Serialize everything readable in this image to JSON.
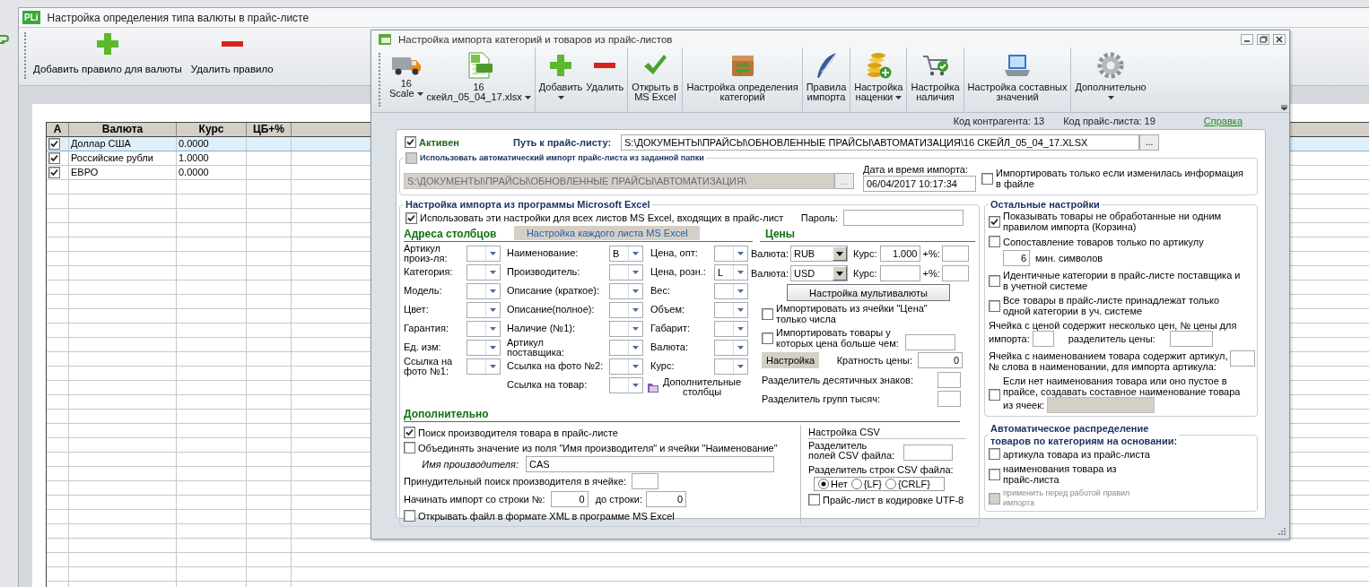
{
  "background_window": {
    "logo": "PLi",
    "title": "Настройка определения типа валюты в прайс-листе",
    "toolbar": [
      {
        "label": "Добавить правило для валюты"
      },
      {
        "label": "Удалить правило"
      }
    ],
    "table": {
      "check_column": "А",
      "columns": [
        "Валюта",
        "Курс",
        "ЦБ+%"
      ],
      "rows": [
        {
          "selected": true,
          "checked": true,
          "cells": [
            "Доллар США",
            "0.0000"
          ]
        },
        {
          "selected": false,
          "checked": true,
          "cells": [
            "Российские рубли",
            "1.0000"
          ]
        },
        {
          "selected": false,
          "checked": true,
          "cells": [
            "ЕВРО",
            "0.0000"
          ]
        }
      ]
    }
  },
  "dialog": {
    "title": "Настройка импорта категорий и товаров из прайс-листов",
    "toolbar": [
      [
        {
          "caption": "16",
          "label": "Scale",
          "dropdown": true
        },
        {
          "caption": "16",
          "label": "скейл_05_04_17.xlsx",
          "dropdown": true
        }
      ],
      [
        {
          "label": "Добавить",
          "dropdown": true
        },
        {
          "label": "Удалить",
          "dropdown": false
        }
      ],
      [
        {
          "label": "Открыть в\nMS Excel",
          "dropdown": false
        }
      ],
      [
        {
          "label": "Настройка определения\nкатегорий",
          "dropdown": false
        }
      ],
      [
        {
          "label": "Правила\nимпорта",
          "dropdown": false
        }
      ],
      [
        {
          "label": "Настройка\nнаценки",
          "dropdown": true
        }
      ],
      [
        {
          "label": "Настройка\nналичия",
          "dropdown": false
        }
      ],
      [
        {
          "label": "Настройка составных\nзначений",
          "dropdown": false
        }
      ],
      [
        {
          "label": "Дополнительно",
          "dropdown": true
        }
      ]
    ],
    "info": {
      "counterparty": "Код контрагента: 13",
      "pricelist": "Код прайс-листа: 19",
      "help": "Справка"
    },
    "active": {
      "label": "Активен",
      "checked": true
    },
    "path": {
      "label": "Путь к прайс-листу:",
      "value": "S:\\ДОКУМЕНТЫ\\ПРАЙСЫ\\ОБНОВЛЕННЫЕ ПРАЙСЫ\\АВТОМАТИЗАЦИЯ\\16 СКЕЙЛ_05_04_17.XLSX",
      "browse": "..."
    },
    "auto_import": {
      "label": "Использовать автоматический импорт прайс-листа из заданной папки",
      "checked": false,
      "folder": "S:\\ДОКУМЕНТЫ\\ПРАЙСЫ\\ОБНОВЛЕННЫЕ ПРАЙСЫ\\АВТОМАТИЗАЦИЯ\\",
      "browse": "...",
      "disabled": true,
      "date_label": "Дата и время импорта:",
      "date_value": "06/04/2017 10:17:34",
      "only_changed": {
        "label": "Импортировать только если изменилась информация\nв файле",
        "checked": false
      }
    },
    "excel": {
      "title": "Настройка импорта из программы Microsoft Excel",
      "all_sheets": {
        "label": "Использовать эти настройки для всех листов MS Excel, входящих в прайс-лист",
        "checked": true
      },
      "password_label": "Пароль:",
      "columns_title": "Адреса столбцов",
      "each_sheet_button": "Настройка каждого листа MS Excel",
      "column_groups": [
        [
          {
            "label": "Артикул\nпроиз-ля:"
          },
          {
            "label": "Категория:"
          },
          {
            "label": "Модель:"
          },
          {
            "label": "Цвет:"
          },
          {
            "label": "Гарантия:"
          },
          {
            "label": "Ед. изм:"
          },
          {
            "label": "Ссылка на\nфото №1:"
          }
        ],
        [
          {
            "label": "Наименование:",
            "value": "B"
          },
          {
            "label": "Производитель:"
          },
          {
            "label": "Описание (краткое):"
          },
          {
            "label": "Описание(полное):"
          },
          {
            "label": "Наличие (№1):"
          },
          {
            "label": "Артикул\nпоставщика:"
          },
          {
            "label": "Ссылка на фото №2:"
          },
          {
            "label": "Ссылка на товар:"
          }
        ],
        [
          {
            "label": "Цена, опт:"
          },
          {
            "label": "Цена, розн.:",
            "value": "L"
          },
          {
            "label": "Вес:"
          },
          {
            "label": "Объем:"
          },
          {
            "label": "Габарит:"
          },
          {
            "label": "Валюта:"
          },
          {
            "label": "Курс:"
          }
        ]
      ],
      "extra_columns": "Дополнительные\nстолбцы",
      "prices": {
        "title": "Цены",
        "currencies": [
          {
            "label": "Валюта:",
            "value": "RUB",
            "rate_label": "Курс:",
            "rate": "1.000",
            "percent_label": "+%:"
          },
          {
            "label": "Валюта:",
            "value": "USD",
            "rate_label": "Курс:",
            "percent_label": "+%:"
          }
        ],
        "multi_button": "Настройка мультивалюты",
        "numbers_only": {
          "label": "Импортировать из ячейки \"Цена\"\nтолько числа",
          "checked": false
        },
        "min_price": {
          "label": "Импортировать товары у\nкоторых цена больше чем:",
          "checked": false
        },
        "settings_button": "Настройка",
        "multiplicity_label": "Кратность цены:",
        "multiplicity": "0",
        "decimal_label": "Разделитель десятичных знаков:",
        "thousands_label": "Разделитель групп тысяч:"
      },
      "more_title": "Дополнительно",
      "more": {
        "find_maker": {
          "label": "Поиск производителя товара в прайс-листе",
          "checked": true
        },
        "merge": {
          "label": "Объединять значение из поля \"Имя производителя\" и ячейки \"Наименование\"",
          "checked": false
        },
        "maker_label": "Имя производителя:",
        "maker_value": "CAS",
        "forced_label": "Принудительный поиск производителя в ячейке:",
        "start_label": "Начинать импорт со строки №:",
        "start_value": "0",
        "end_label": "до строки:",
        "end_value": "0",
        "xml": {
          "label": "Открывать файл в формате XML в программе MS Excel",
          "checked": false
        }
      },
      "csv": {
        "title": "Настройка CSV",
        "field_sep_label": "Разделитель\nполей CSV файла:",
        "row_sep_label": "Разделитель строк CSV файла:",
        "row_sep_options": [
          {
            "label": "Нет",
            "selected": true
          },
          {
            "label": "{LF}",
            "selected": false
          },
          {
            "label": "{CRLF}",
            "selected": false
          }
        ],
        "utf8": {
          "label": "Прайс-лист в кодировке UTF-8",
          "checked": false
        }
      }
    },
    "other": {
      "title": "Остальные настройки",
      "items": [
        {
          "kind": "check",
          "label": "Показывать товары не обработанные ни одним\nправилом импорта (Корзина)",
          "checked": true
        },
        {
          "kind": "check_min",
          "label": "Сопоставление товаров только по артикулу",
          "checked": false,
          "min_value": "6",
          "min_label": "мин. символов"
        },
        {
          "kind": "check",
          "label": "Идентичные категории в прайс-листе поставщика и\nв учетной системе",
          "checked": false
        },
        {
          "kind": "check",
          "label": "Все товары в прайс-листе принадлежат только\nодной категории в уч. системе",
          "checked": false
        },
        {
          "kind": "price_index",
          "label": "Ячейка с ценой содержит несколько цен, № цены для",
          "label_2": "импорта:",
          "separator_label": "разделитель цены:"
        },
        {
          "kind": "article_word",
          "label": "Ячейка с наименованием товара содержит артикул,\n№ слова в наименовании, для импорта артикула:"
        },
        {
          "kind": "composite",
          "label": "Если нет наименования товара или оно пустое в\nпрайсе, создавать составное наименование товара",
          "label_2": "из ячеек:",
          "checked": false
        }
      ]
    },
    "auto_distribution": {
      "title": "Автоматическое распределение\nтоваров по категориям на основании:",
      "items": [
        {
          "label": "артикула товара из прайс-листа",
          "checked": false,
          "disabled": false
        },
        {
          "label": "наименования товара из\nпрайс-листа",
          "checked": false,
          "disabled": false
        },
        {
          "label": "применить перед работой правил\nимпорта",
          "checked": false,
          "disabled": true
        }
      ]
    }
  }
}
